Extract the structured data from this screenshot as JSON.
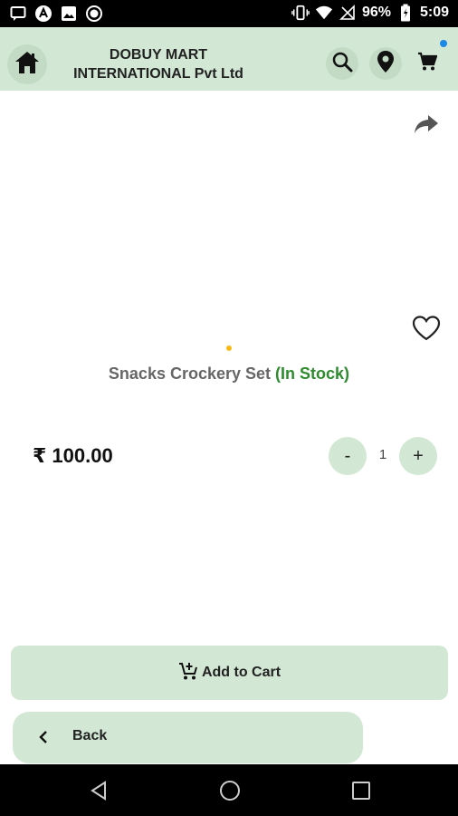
{
  "status_bar": {
    "battery": "96%",
    "time": "5:09",
    "left_icons": [
      "message-icon",
      "app-a-icon",
      "image-icon",
      "record-icon"
    ],
    "right_icons": [
      "vibrate-icon",
      "wifi-icon",
      "no-signal-icon",
      "battery-icon"
    ]
  },
  "header": {
    "brand_line1": "DOBUY MART",
    "brand_line2": "INTERNATIONAL Pvt Ltd",
    "icons": [
      "home-icon",
      "search-icon",
      "location-icon",
      "cart-icon"
    ],
    "cart_badge_color": "#1e88e5"
  },
  "product": {
    "name": "Snacks Crockery Set",
    "stock": "(In Stock)",
    "price": "₹ 100.00",
    "quantity": "1",
    "minus_label": "-",
    "plus_label": "+"
  },
  "actions": {
    "add_to_cart": "Add to Cart",
    "back": "Back"
  },
  "colors": {
    "accent": "#d2e8d4",
    "stock_green": "#2e8b2e",
    "indicator_dot": "#f9b917"
  }
}
